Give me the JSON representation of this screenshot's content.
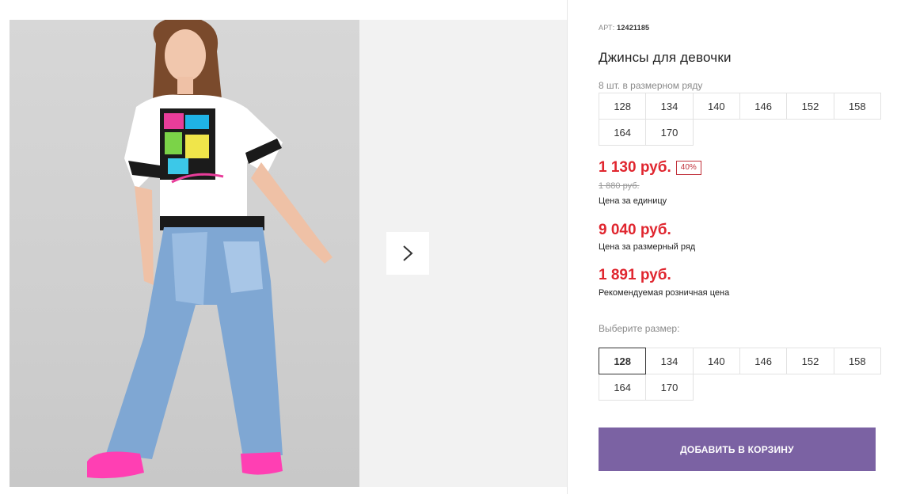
{
  "gallery": {
    "image_alt": "product-photo",
    "next_icon": "chevron-right-icon"
  },
  "product": {
    "art_label": "АРТ:",
    "art_number": "12421185",
    "title": "Джинсы для девочки",
    "pack_note": "8 шт. в размерном ряду",
    "pack_sizes": [
      "128",
      "134",
      "140",
      "146",
      "152",
      "158",
      "164",
      "170"
    ],
    "price": "1 130 руб.",
    "discount": "40%",
    "old_price": "1 880 руб.",
    "unit_price_label": "Цена за единицу",
    "pack_price": "9 040 руб.",
    "pack_price_label": "Цена за размерный ряд",
    "retail_price": "1 891 руб.",
    "retail_price_label": "Рекомендуемая розничная цена",
    "choose_size_label": "Выберите размер:",
    "select_sizes": [
      "128",
      "134",
      "140",
      "146",
      "152",
      "158",
      "164",
      "170"
    ],
    "selected_size": "128",
    "add_to_cart": "ДОБАВИТЬ В КОРЗИНУ"
  },
  "colors": {
    "accent_red": "#e0262f",
    "button_purple": "#7b62a3"
  }
}
